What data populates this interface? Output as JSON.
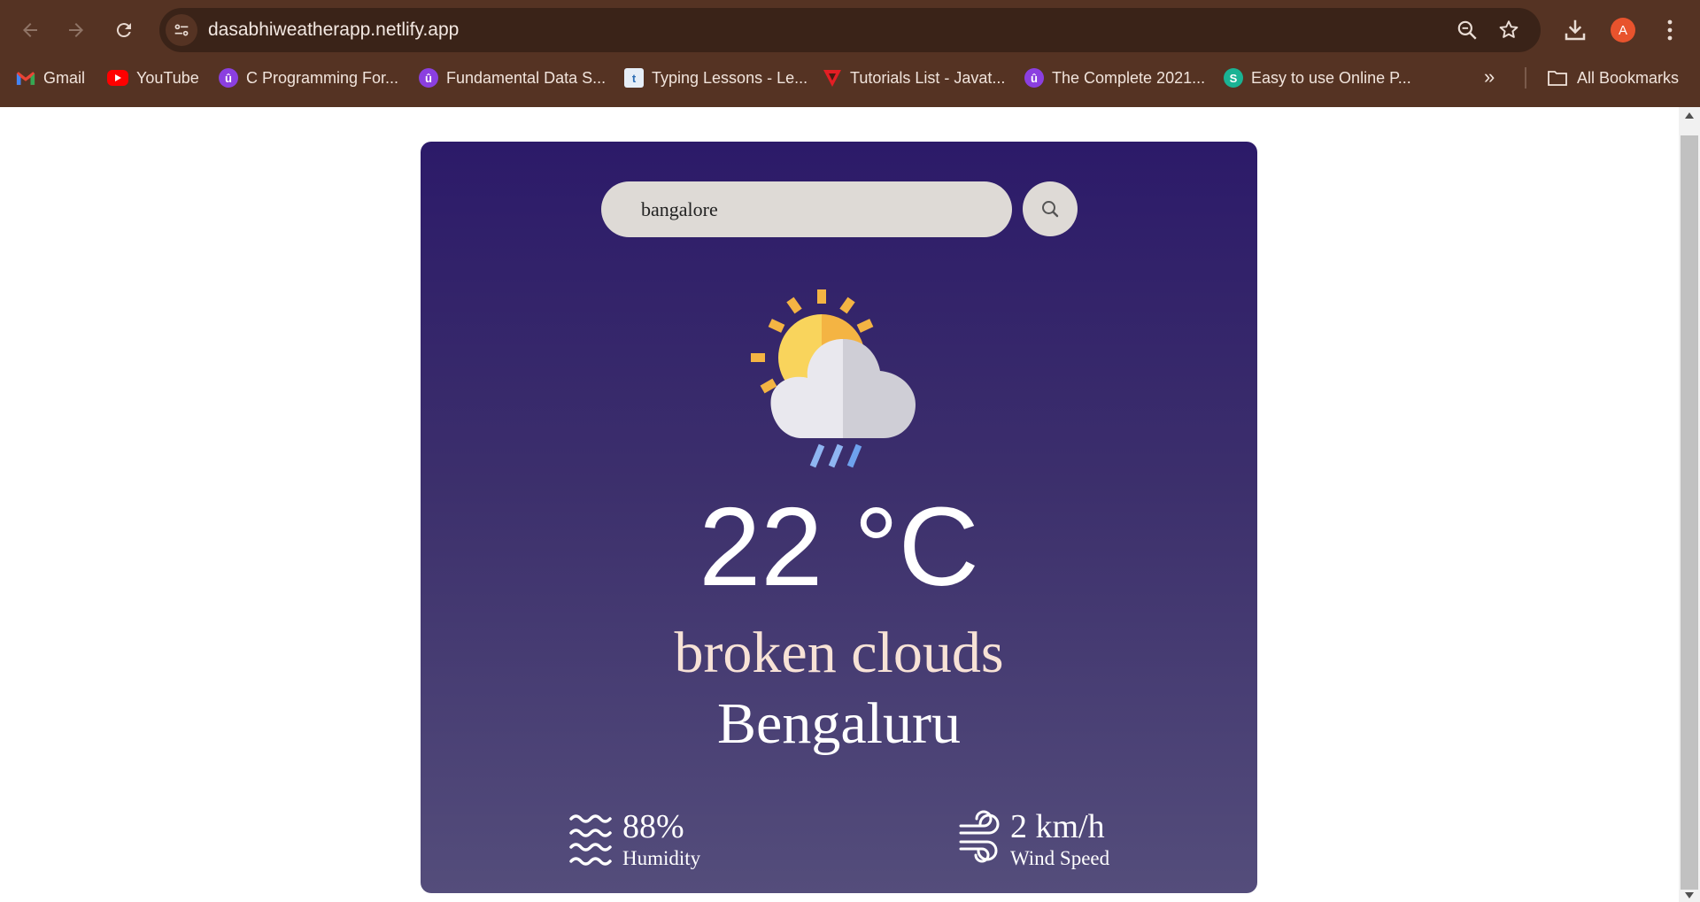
{
  "browser": {
    "url": "dasabhiweatherapp.netlify.app",
    "avatar_letter": "A",
    "bookmarks": [
      {
        "label": "Gmail",
        "icon": "gmail-icon"
      },
      {
        "label": "YouTube",
        "icon": "youtube-icon"
      },
      {
        "label": "C Programming For...",
        "icon": "udemy-icon"
      },
      {
        "label": "Fundamental Data S...",
        "icon": "udemy-icon"
      },
      {
        "label": "Typing Lessons - Le...",
        "icon": "typing-icon"
      },
      {
        "label": "Tutorials List - Javat...",
        "icon": "javatpoint-icon"
      },
      {
        "label": "The Complete 2021...",
        "icon": "udemy-icon"
      },
      {
        "label": "Easy to use Online P...",
        "icon": "smallpdf-icon"
      }
    ],
    "all_bookmarks_label": "All Bookmarks"
  },
  "weather": {
    "search_value": "bangalore",
    "temperature": "22 °C",
    "description": "broken clouds",
    "city": "Bengaluru",
    "humidity_value": "88%",
    "humidity_label": "Humidity",
    "wind_value": "2 km/h",
    "wind_label": "Wind Speed",
    "condition_icon": "sun-cloud-rain-icon"
  },
  "colors": {
    "card_top": "#2c1a69",
    "card_bottom": "#544d7b",
    "chrome_bg": "#553323",
    "description_text": "#f7e2d6"
  }
}
